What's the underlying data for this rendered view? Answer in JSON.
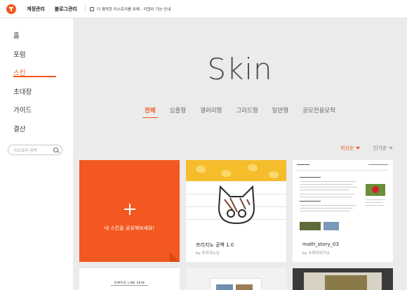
{
  "topbar": {
    "account": "계정관리",
    "blog": "블로그관리",
    "notice": "더 쾌적한 티스토리를 위해 - 리캡차 기능 안내"
  },
  "sidebar": {
    "items": [
      {
        "label": "홈"
      },
      {
        "label": "포럼"
      },
      {
        "label": "스킨",
        "active": true
      },
      {
        "label": "초대장"
      },
      {
        "label": "가이드"
      },
      {
        "label": "결산"
      }
    ],
    "search_placeholder": "티스토리 검색"
  },
  "hero": {
    "title": "Skin"
  },
  "tabs": [
    {
      "label": "전체",
      "active": true
    },
    {
      "label": "심플형"
    },
    {
      "label": "갤러리형"
    },
    {
      "label": "그리드형"
    },
    {
      "label": "일반형"
    },
    {
      "label": "공모전용모작"
    }
  ],
  "sort": {
    "latest": "최신순",
    "popular": "인기순"
  },
  "share_card": {
    "label": "내 스킨을 공유해보세요!"
  },
  "skins": [
    {
      "title": "프리지노 공백 1.0",
      "author": "by 프리지노닝"
    },
    {
      "title": "math_story_03",
      "author": "by 수학이야기닝"
    }
  ],
  "row2": {
    "simple_line": "SIMPLE LINE SKIN"
  },
  "colors": {
    "accent": "#f2581f",
    "background": "#ebebeb"
  },
  "icons": [
    "tistory-logo-icon",
    "notice-icon",
    "search-icon",
    "plus-icon",
    "caret-down-icon"
  ]
}
